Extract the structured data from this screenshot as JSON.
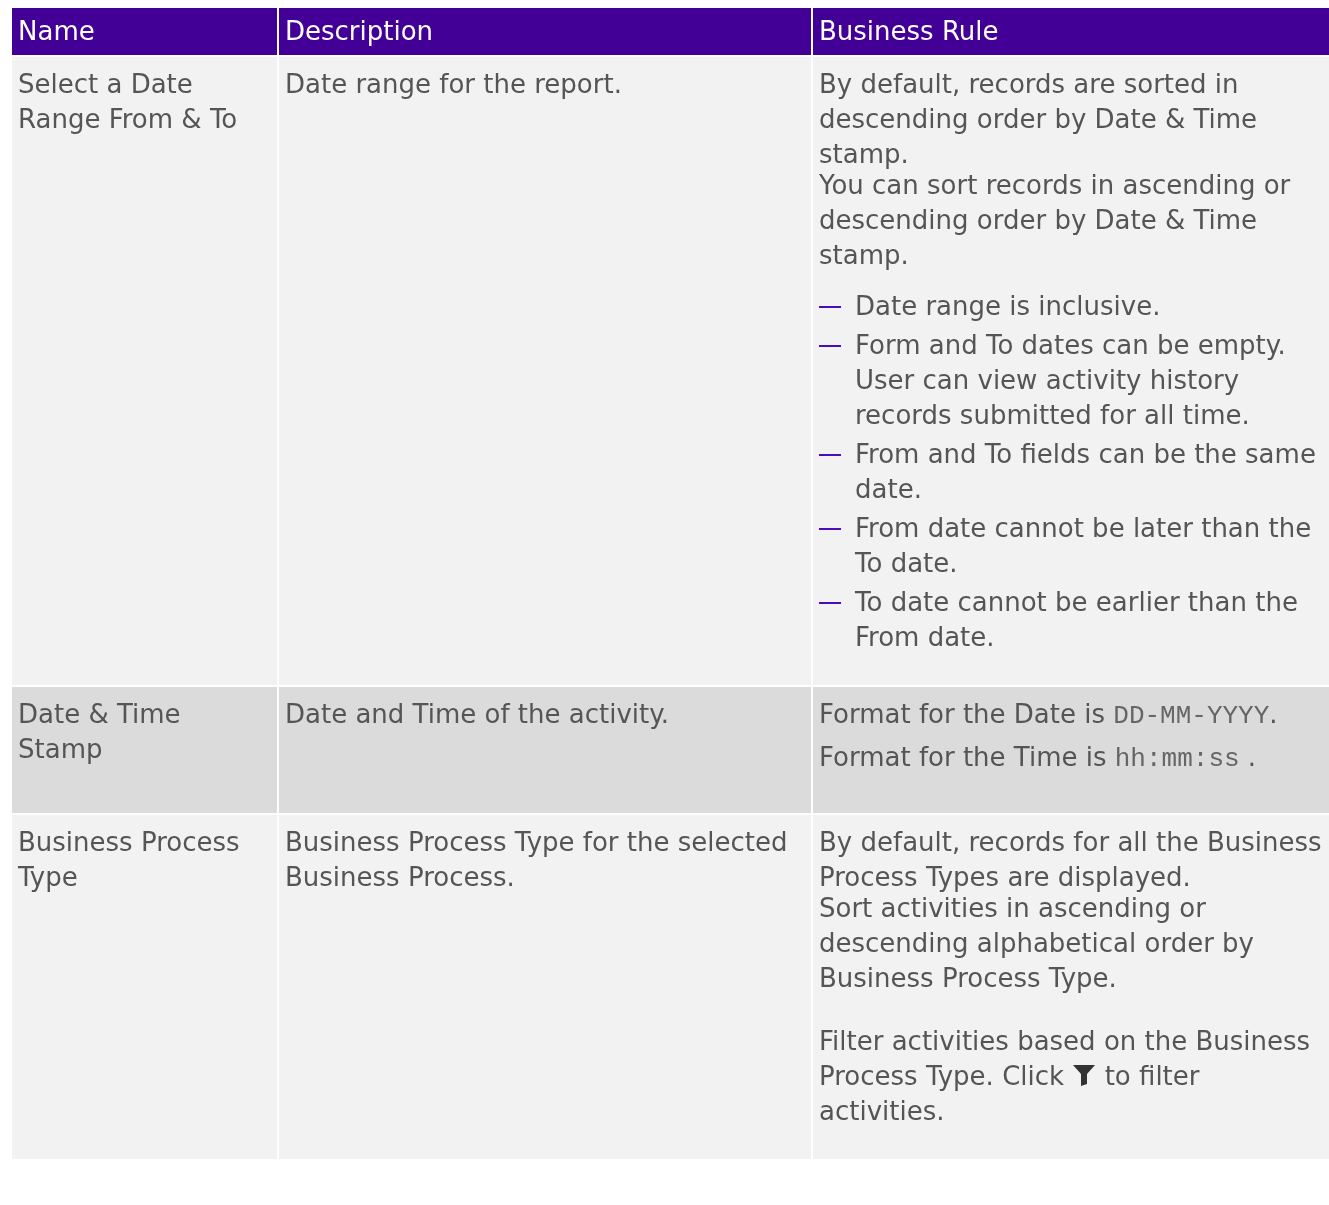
{
  "table": {
    "columns": [
      "Name",
      "Description",
      "Business Rule"
    ],
    "rows": [
      {
        "name": "Select a Date Range From & To",
        "description": "Date range for the report.",
        "shaded": false,
        "rule": [
          {
            "kind": "text",
            "text": "By default, records are sorted in descending order by Date & Time stamp."
          },
          {
            "kind": "text",
            "text": "You can sort records in ascending or descending order by Date & Time stamp."
          },
          {
            "kind": "list",
            "items": [
              "Date range is inclusive.",
              "Form and To dates can be empty. User can view activity history records submitted for all time.",
              "From and To fields can be the same date.",
              "From date cannot be later than the To date.",
              "To date cannot be earlier than the From date."
            ]
          }
        ]
      },
      {
        "name": "Date & Time Stamp",
        "description": "Date and Time of the activity.",
        "shaded": true,
        "rule": [
          {
            "kind": "code",
            "before": "Format for the Date is ",
            "code": "DD-MM-YYYY",
            "after": "."
          },
          {
            "kind": "code",
            "before": "Format for the Time is ",
            "code": "hh:mm:ss",
            "after": " ."
          }
        ]
      },
      {
        "name": "Business Process Type",
        "description": "Business Process Type for the selected Business Process.",
        "shaded": false,
        "rule": [
          {
            "kind": "text",
            "text": "By default, records for all the Business Process Types are displayed."
          },
          {
            "kind": "text",
            "text": "Sort activities in ascending or descending alphabetical order by Business Process Type."
          },
          {
            "kind": "icon",
            "before": "Filter activities based on the Business Process Type. Click ",
            "after": " to filter activities."
          }
        ]
      }
    ]
  }
}
